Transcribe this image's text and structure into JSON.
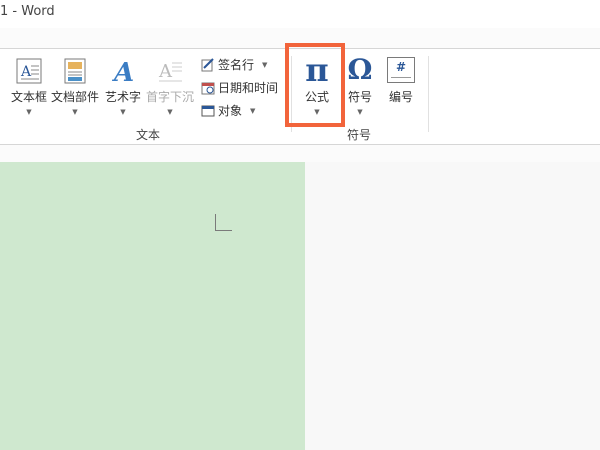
{
  "window": {
    "title": "1 - Word"
  },
  "ribbon": {
    "text_group": {
      "label": "文本",
      "textbox": "文本框",
      "quickparts": "文档部件",
      "wordart": "艺术字",
      "dropcap": "首字下沉",
      "signature_line": "签名行",
      "date_time": "日期和时间",
      "object": "对象"
    },
    "symbols_group": {
      "label": "符号",
      "equation": "公式",
      "equation_glyph": "π",
      "symbol": "符号",
      "symbol_glyph": "Ω",
      "number": "编号",
      "number_glyph": "#"
    }
  },
  "colors": {
    "highlight": "#f2643b",
    "page": "#cfe8cf",
    "accent": "#2b5797"
  }
}
